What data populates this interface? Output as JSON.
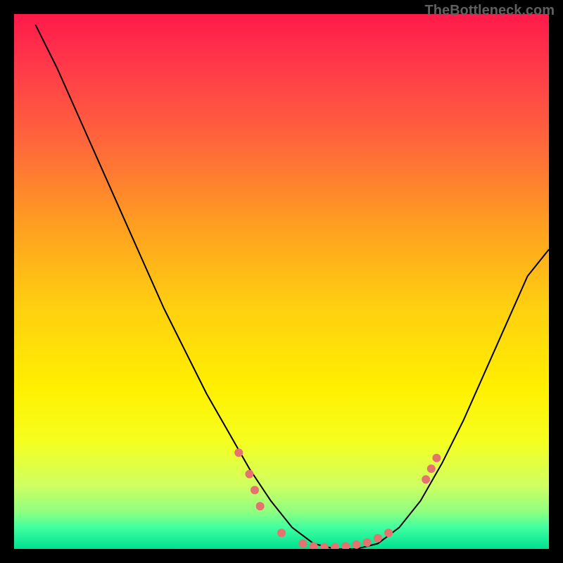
{
  "attribution": "TheBottleneck.com",
  "chart_data": {
    "type": "line",
    "title": "",
    "xlabel": "",
    "ylabel": "",
    "ylim": [
      0,
      100
    ],
    "xlim": [
      0,
      100
    ],
    "series": [
      {
        "name": "curve",
        "x": [
          4,
          8,
          12,
          16,
          20,
          24,
          28,
          32,
          36,
          40,
          44,
          48,
          52,
          56,
          60,
          64,
          68,
          72,
          76,
          80,
          84,
          88,
          92,
          96,
          100
        ],
        "y": [
          98,
          90,
          81,
          72,
          63,
          54,
          45,
          37,
          29,
          22,
          15,
          9,
          4,
          1,
          0,
          0,
          1,
          4,
          9,
          16,
          24,
          33,
          42,
          51,
          56
        ]
      }
    ],
    "markers": [
      {
        "x": 42,
        "y": 18
      },
      {
        "x": 44,
        "y": 14
      },
      {
        "x": 45,
        "y": 11
      },
      {
        "x": 46,
        "y": 8
      },
      {
        "x": 50,
        "y": 3
      },
      {
        "x": 54,
        "y": 1
      },
      {
        "x": 56,
        "y": 0.5
      },
      {
        "x": 58,
        "y": 0.3
      },
      {
        "x": 60,
        "y": 0.3
      },
      {
        "x": 62,
        "y": 0.5
      },
      {
        "x": 64,
        "y": 0.8
      },
      {
        "x": 66,
        "y": 1.2
      },
      {
        "x": 68,
        "y": 2
      },
      {
        "x": 70,
        "y": 3
      },
      {
        "x": 77,
        "y": 13
      },
      {
        "x": 78,
        "y": 15
      },
      {
        "x": 79,
        "y": 17
      }
    ],
    "gradient_colors": {
      "top": "#ff1a4a",
      "middle": "#ffd010",
      "bottom": "#00e090"
    }
  }
}
